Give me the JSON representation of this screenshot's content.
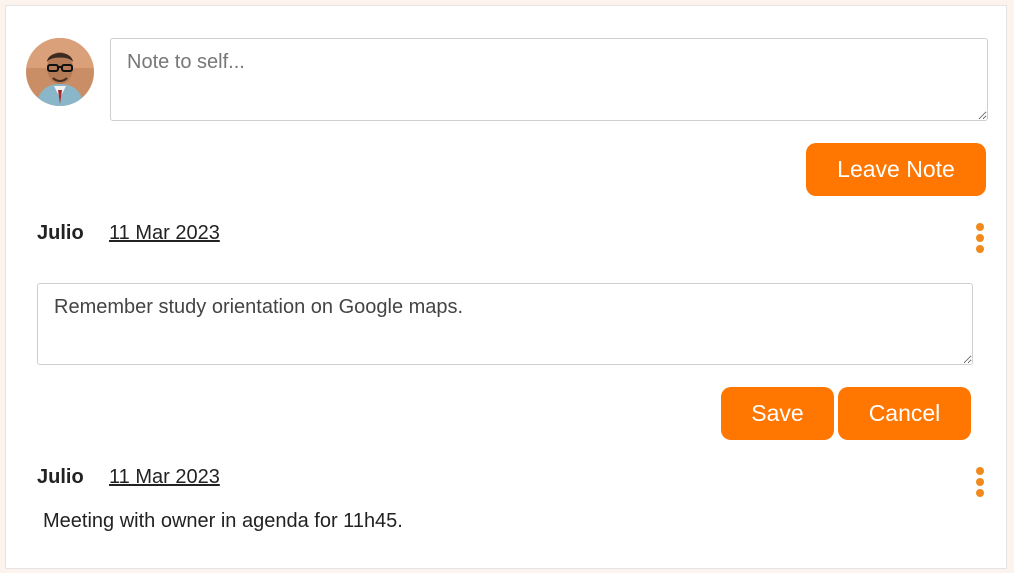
{
  "composer": {
    "placeholder": "Note to self...",
    "submit_label": "Leave Note"
  },
  "notes": [
    {
      "author": "Julio",
      "date": "11 Mar 2023",
      "editing": true,
      "edit_value": "Remember study orientation on Google maps.",
      "save_label": "Save",
      "cancel_label": "Cancel",
      "menu_icon": "kebab-menu-icon"
    },
    {
      "author": "Julio",
      "date": "11 Mar 2023",
      "editing": false,
      "text": "Meeting with owner in agenda for 11h45.",
      "menu_icon": "kebab-menu-icon"
    }
  ],
  "colors": {
    "accent": "#ff7600",
    "menu_dots": "#f08a1c"
  }
}
